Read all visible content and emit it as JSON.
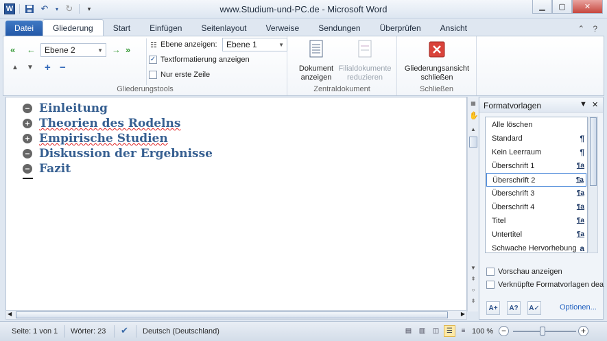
{
  "window": {
    "title": "www.Studium-und-PC.de  -  Microsoft Word",
    "app_icon_letter": "W"
  },
  "tabs": [
    {
      "label": "Datei"
    },
    {
      "label": "Gliederung"
    },
    {
      "label": "Start"
    },
    {
      "label": "Einfügen"
    },
    {
      "label": "Seitenlayout"
    },
    {
      "label": "Verweise"
    },
    {
      "label": "Sendungen"
    },
    {
      "label": "Überprüfen"
    },
    {
      "label": "Ansicht"
    }
  ],
  "ribbon": {
    "outline_tools": {
      "group_label": "Gliederungstools",
      "level_combo": "Ebene 2",
      "show_level_label": "Ebene anzeigen:",
      "show_level_value": "Ebene 1",
      "show_formatting": {
        "label": "Textformatierung anzeigen",
        "checked": true
      },
      "first_line_only": {
        "label": "Nur erste Zeile",
        "checked": false
      }
    },
    "master_doc": {
      "group_label": "Zentraldokument",
      "show_document": "Dokument anzeigen",
      "collapse_subdocs": "Filialdokumente reduzieren"
    },
    "close": {
      "group_label": "Schließen",
      "close_outline": "Gliederungsansicht schließen"
    }
  },
  "document": {
    "headings": [
      {
        "text": "Einleitung",
        "icon": "minus"
      },
      {
        "text": "Theorien des Rodelns",
        "icon": "plus"
      },
      {
        "text": "Empirische Studien",
        "icon": "plus"
      },
      {
        "text": "Diskussion der Ergebnisse",
        "icon": "minus"
      },
      {
        "text": "Fazit",
        "icon": "minus"
      }
    ]
  },
  "styles_pane": {
    "title": "Formatvorlagen",
    "items": [
      {
        "label": "Alle löschen",
        "symbol": ""
      },
      {
        "label": "Standard",
        "symbol": "¶"
      },
      {
        "label": "Kein Leerraum",
        "symbol": "¶"
      },
      {
        "label": "Überschrift 1",
        "symbol": "¶a"
      },
      {
        "label": "Überschrift 2",
        "symbol": "¶a",
        "selected": true
      },
      {
        "label": "Überschrift 3",
        "symbol": "¶a"
      },
      {
        "label": "Überschrift 4",
        "symbol": "¶a"
      },
      {
        "label": "Titel",
        "symbol": "¶a"
      },
      {
        "label": "Untertitel",
        "symbol": "¶a"
      },
      {
        "label": "Schwache Hervorhebung",
        "symbol": "a"
      }
    ],
    "preview_label": "Vorschau anzeigen",
    "linked_label": "Verknüpfte Formatvorlagen dea",
    "options_link": "Optionen..."
  },
  "statusbar": {
    "page": "Seite: 1 von 1",
    "words": "Wörter: 23",
    "language": "Deutsch (Deutschland)",
    "zoom": "100 %",
    "zoom_level": 100
  },
  "colors": {
    "heading": "#365f91",
    "file_tab": "#2b579a",
    "close_red": "#c6473e"
  }
}
